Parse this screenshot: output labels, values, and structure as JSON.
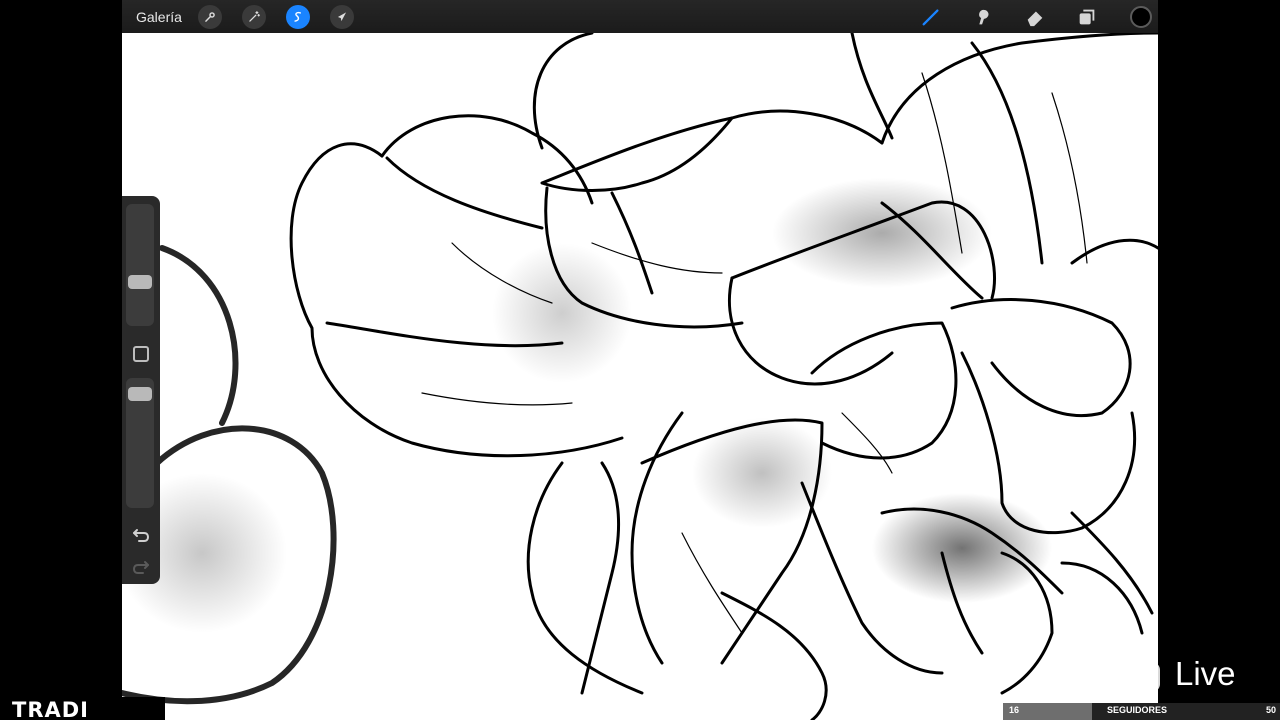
{
  "app": {
    "gallery_label": "Galería",
    "toolbar_left": [
      {
        "icon": "wrench-icon",
        "active": false
      },
      {
        "icon": "magic-wand-icon",
        "active": false
      },
      {
        "icon": "selection-icon",
        "active": true
      },
      {
        "icon": "transform-arrow-icon",
        "active": false
      }
    ],
    "toolbar_right": [
      {
        "icon": "brush-icon",
        "active": true
      },
      {
        "icon": "smudge-icon",
        "active": false
      },
      {
        "icon": "eraser-icon",
        "active": false
      },
      {
        "icon": "layers-icon",
        "active": false
      }
    ],
    "current_color": "#000000",
    "accent_color": "#1a84ff",
    "brush_size_level": 0.22,
    "opacity_level": 0.08
  },
  "overlay": {
    "brand": "TRADI",
    "live_label": "Live",
    "followers": {
      "current": "16",
      "label": "SEGUIDORES",
      "goal": "50",
      "progress": 0.32
    }
  }
}
